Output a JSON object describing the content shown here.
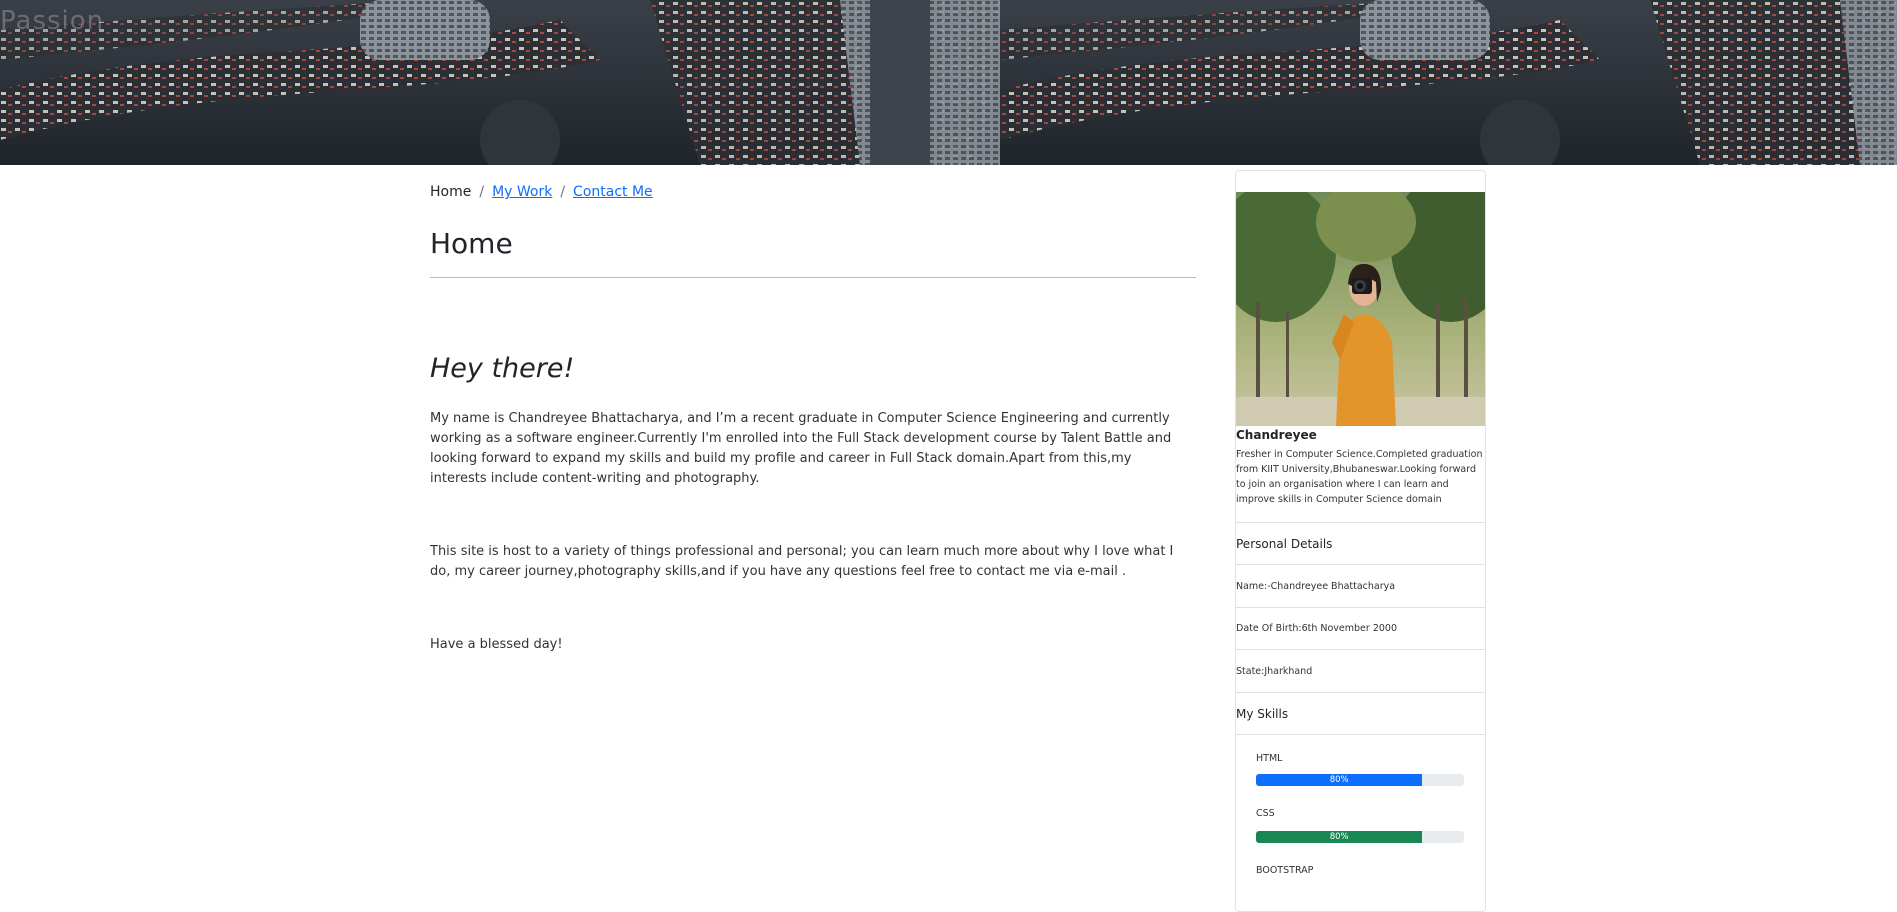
{
  "banner": {
    "title": "Passion"
  },
  "breadcrumb": {
    "home": "Home",
    "separator": "/",
    "work": "My Work",
    "contact": "Contact Me"
  },
  "main": {
    "title": "Home",
    "greeting": "Hey there!",
    "paragraphs": [
      "My name is Chandreyee Bhattacharya, and I’m a recent graduate in Computer Science Engineering and currently working as a software engineer.Currently I'm enrolled into the Full Stack development course by Talent Battle and looking forward to expand my skills and build my profile and career in Full Stack domain.Apart from this,my interests include content-writing and photography.",
      "This site is host to a variety of things professional and personal; you can learn much more about why I love what I do, my career journey,photography skills,and if you have any questions feel free to contact me via e-mail .",
      "Have a blessed day!"
    ]
  },
  "profile": {
    "name": "Chandreyee",
    "bio": "Fresher in Computer Science.Completed graduation from KIIT University,Bhubaneswar.Looking forward to join an organisation where I can learn and improve skills in Computer Science domain",
    "personal_heading": "Personal Details",
    "details": {
      "name": "Name:-Chandreyee Bhattacharya",
      "dob": "Date Of Birth:6th November 2000",
      "state": "State:Jharkhand"
    },
    "skills_heading": "My Skills",
    "skills": [
      {
        "name": "HTML",
        "label": "80%",
        "percent": 80,
        "color": "#0d6efd"
      },
      {
        "name": "CSS",
        "label": "80%",
        "percent": 80,
        "color": "#198754"
      },
      {
        "name": "BOOTSTRAP"
      }
    ]
  }
}
